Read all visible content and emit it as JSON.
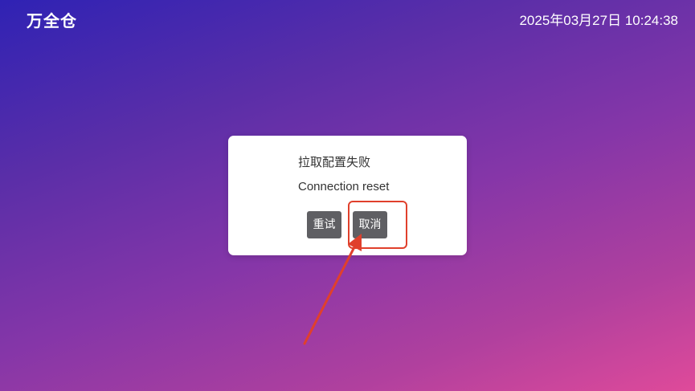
{
  "header": {
    "app_title": "万全仓",
    "datetime": "2025年03月27日 10:24:38"
  },
  "dialog": {
    "title": "拉取配置失败",
    "message": "Connection reset",
    "retry_label": "重试",
    "cancel_label": "取消"
  },
  "annotation": {
    "color": "#e0402c"
  }
}
